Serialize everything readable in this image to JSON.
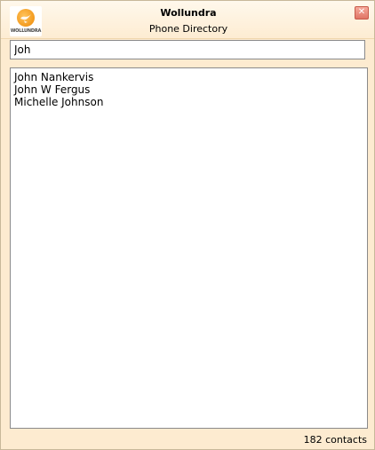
{
  "header": {
    "logo_text": "WOLLUNDRA",
    "title": "Wollundra",
    "subtitle": "Phone Directory",
    "close_glyph": "✕"
  },
  "search": {
    "value": "Joh",
    "placeholder": ""
  },
  "results": [
    {
      "name": "John Nankervis"
    },
    {
      "name": "John W Fergus"
    },
    {
      "name": "Michelle Johnson"
    }
  ],
  "footer": {
    "count": "182 contacts"
  },
  "colors": {
    "window_bg": "#fdebd0",
    "logo_orange": "#f39a1e",
    "close_red": "#e07565"
  }
}
